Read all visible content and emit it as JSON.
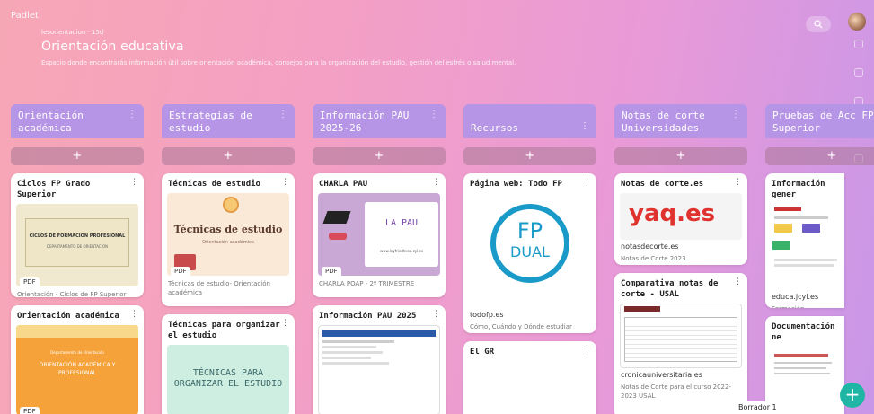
{
  "app": {
    "brand": "Padlet"
  },
  "header": {
    "crumb": "lesorientacion · 15d",
    "title": "Orientación educativa",
    "description": "Espacio donde encontrarás información útil sobre orientación académica, consejos para la organización del estudio, gestión del estrés o salud mental."
  },
  "columns": [
    {
      "title": "Orientación académica"
    },
    {
      "title": "Estrategias de estudio"
    },
    {
      "title": "Información PAU 2025-26"
    },
    {
      "title": "Recursos"
    },
    {
      "title": "Notas de corte Universidades"
    },
    {
      "title": "Pruebas de Acc FP Superior"
    }
  ],
  "add_label": "+",
  "menu_glyph": "⋮",
  "cards": {
    "c1a": {
      "title": "Ciclos FP Grado Superior",
      "thumb_title": "CICLOS DE FORMACIÓN PROFESIONAL",
      "thumb_sub": "DEPARTAMENTO DE ORIENTACIÓN",
      "badge": "PDF",
      "caption": "Orientación - Ciclos de FP Superior"
    },
    "c1b": {
      "title": "Orientación académica",
      "thumb_title": "ORIENTACIÓN ACADÉMICA Y PROFESIONAL",
      "thumb_sub": "Departamento de Orientación",
      "badge": "PDF"
    },
    "c2a": {
      "title": "Técnicas de estudio",
      "thumb_title": "Técnicas de estudio",
      "thumb_sub": "Orientación académica",
      "badge": "PDF",
      "caption": "Técnicas de estudio- Orientación académica"
    },
    "c2b": {
      "title": "Técnicas para organizar el estudio",
      "thumb_title": "TÉCNICAS PARA ORGANIZAR EL ESTUDIO"
    },
    "c3a": {
      "title": "CHARLA PAU",
      "thumb_title": "LA PAU",
      "thumb_sub": "www.leyfriedhesa.cyl.es",
      "badge": "PDF",
      "caption": "CHARLA POAP - 2º TRIMESTRE"
    },
    "c3b": {
      "title": "Información PAU 2025"
    },
    "c4a": {
      "title": "Página web: Todo FP",
      "thumb_title": "FP",
      "thumb_sub": "DUAL",
      "url": "todofp.es",
      "caption": "Cómo, Cuándo y Dónde estudiar"
    },
    "c4b": {
      "title": "El GR"
    },
    "c5a": {
      "title": "Notas de corte.es",
      "thumb_title": "yaq.es",
      "url": "notasdecorte.es",
      "caption": "Notas de Corte 2023"
    },
    "c5b": {
      "title": "Comparativa notas de corte - USAL",
      "url": "cronicauniversitaria.es",
      "caption": "Notas de Corte para el curso 2022-2023 USAL"
    },
    "c6a": {
      "title": "Información gener",
      "url": "educa.jcyl.es",
      "caption": "Formación Profesional"
    },
    "c6b": {
      "title": "Documentación ne"
    }
  },
  "draft": {
    "label": "Borrador 1"
  },
  "fab": {
    "label": "+"
  },
  "colors": {
    "accent": "#1fb6a6",
    "column_header": "#b694e6"
  }
}
